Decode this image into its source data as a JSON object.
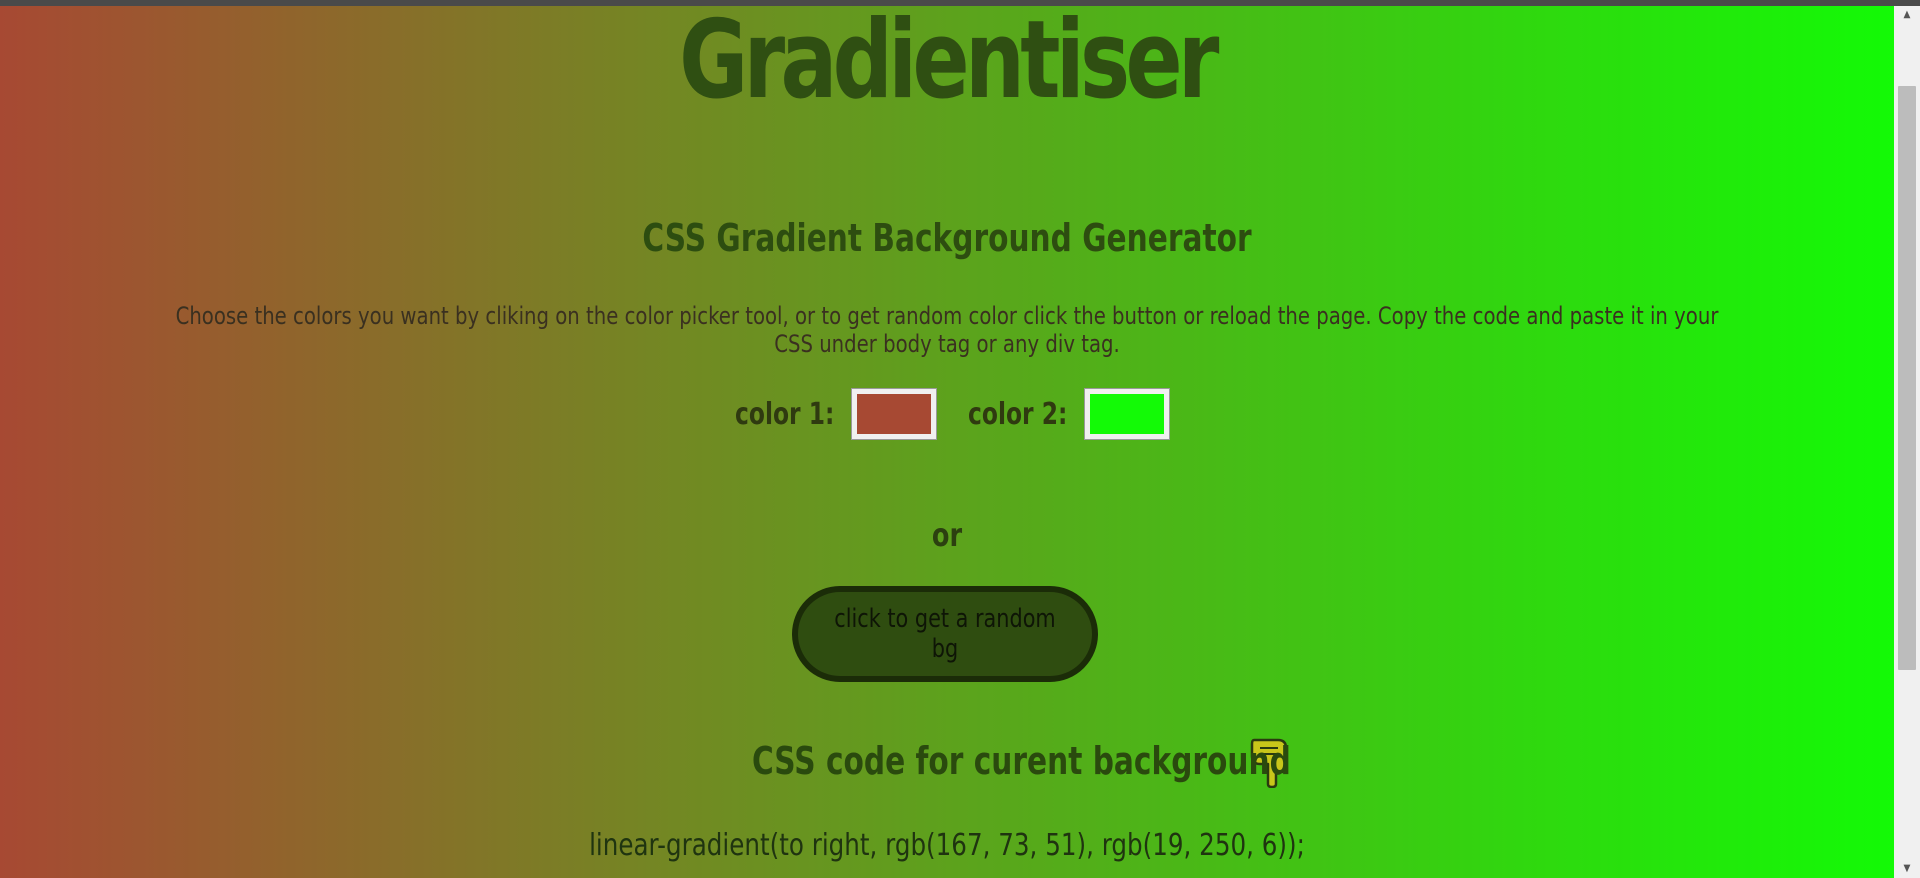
{
  "page": {
    "title": "Gradientiser",
    "subtitle": "CSS Gradient Background Generator",
    "description": "Choose the colors you want by cliking on the color picker tool, or to get random color click the button or reload the page. Copy the code and paste it in your CSS under body tag or any div tag.",
    "or_text": "or"
  },
  "pickers": {
    "color1_label": "color 1:",
    "color1_value": "#a74933",
    "color2_label": "color 2:",
    "color2_value": "#13fa06"
  },
  "button": {
    "label": "click to get a random bg"
  },
  "code_section": {
    "heading": "CSS code for curent background",
    "icon": "pointing-down-hand-icon",
    "code": "linear-gradient(to right, rgb(167, 73, 51), rgb(19, 250, 6));"
  },
  "colors": {
    "gradient_start": "#a74933",
    "gradient_end": "#13fa06",
    "heading_color": "#2f4f12",
    "button_bg": "#2f4d10"
  }
}
